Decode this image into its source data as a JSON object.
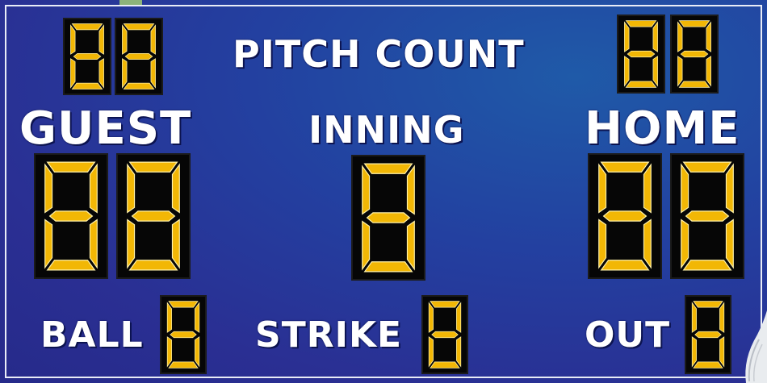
{
  "scoreboard": {
    "labels": {
      "pitch_count": "PITCH COUNT",
      "guest": "GUEST",
      "inning": "INNING",
      "home": "HOME",
      "ball": "BALL",
      "strike": "STRIKE",
      "out": "OUT"
    },
    "display": {
      "segment_color": "#f2b705",
      "segment_edge_color": "#fff1a8",
      "board_color": "#2a3a9c",
      "text_color": "#ffffff"
    }
  }
}
